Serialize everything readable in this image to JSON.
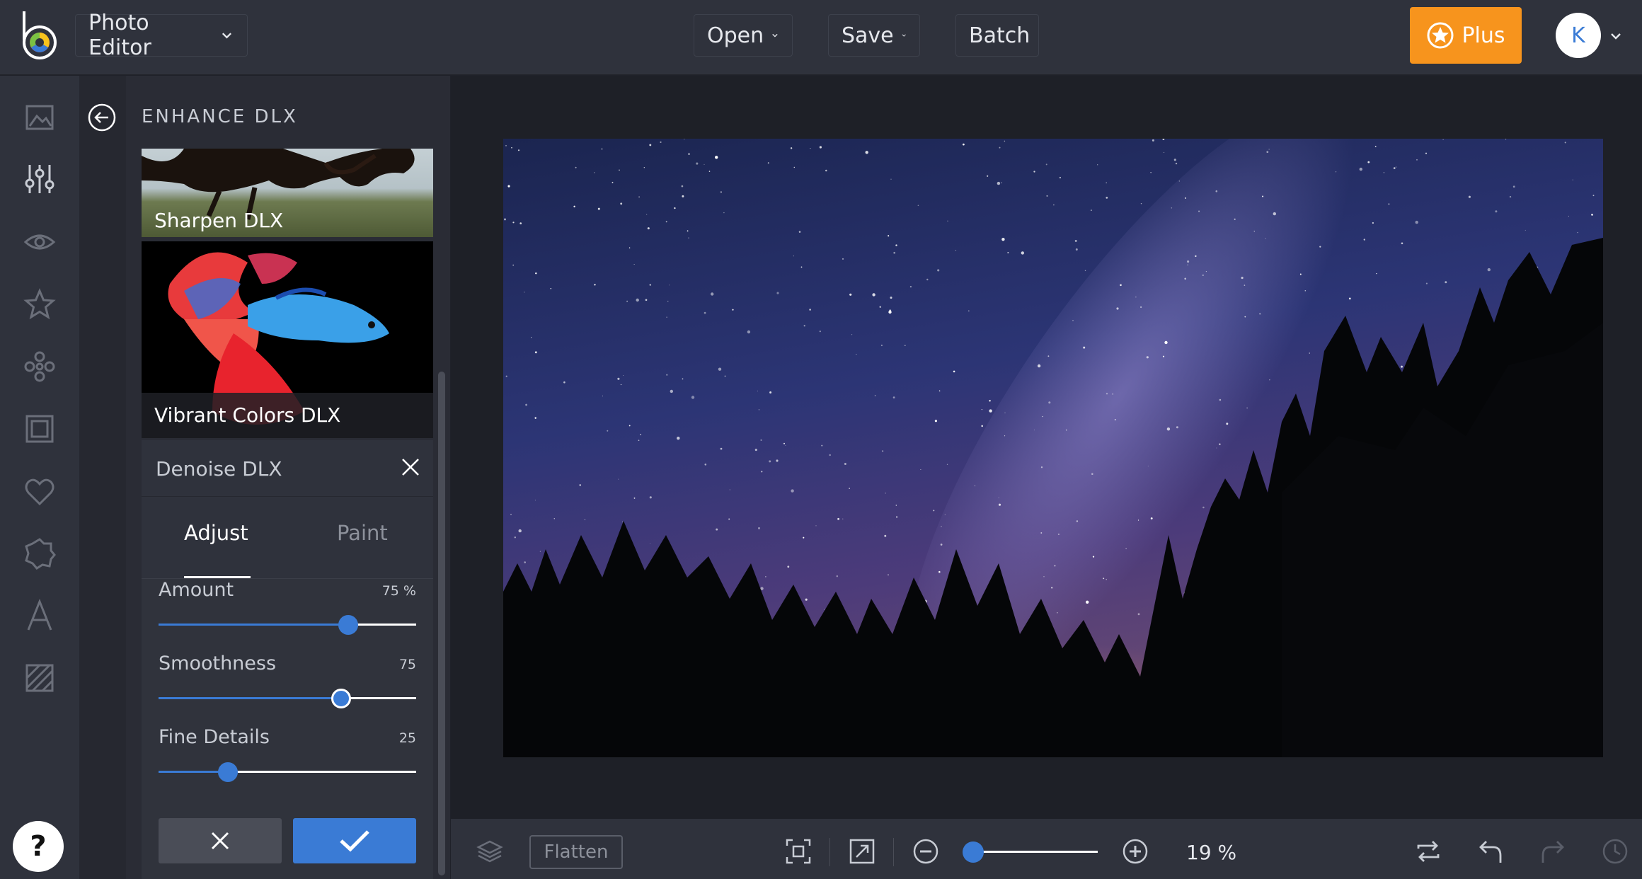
{
  "header": {
    "app_menu_label": "Photo Editor",
    "open_label": "Open",
    "save_label": "Save",
    "batch_label": "Batch",
    "plus_label": "Plus",
    "avatar_initial": "K"
  },
  "rail": {
    "icons": [
      "image-icon",
      "sliders-icon",
      "eye-icon",
      "star-icon",
      "flower-icon",
      "frame-icon",
      "heart-icon",
      "badge-icon",
      "text-icon",
      "texture-icon"
    ],
    "help_label": "?"
  },
  "panel": {
    "title": "ENHANCE DLX",
    "thumbnails": [
      {
        "label": "Sharpen DLX"
      },
      {
        "label": "Vibrant Colors DLX"
      }
    ],
    "tool": {
      "title": "Denoise DLX",
      "tabs": [
        {
          "label": "Adjust",
          "active": true
        },
        {
          "label": "Paint",
          "active": false
        }
      ],
      "sliders": [
        {
          "label": "Amount",
          "value_text": "75 %",
          "value": 0.735
        },
        {
          "label": "Smoothness",
          "value_text": "75",
          "value": 0.71
        },
        {
          "label": "Fine Details",
          "value_text": "25",
          "value": 0.27
        }
      ]
    }
  },
  "bottombar": {
    "flatten_label": "Flatten",
    "zoom_text": "19 %",
    "zoom_level": 0.19
  },
  "colors": {
    "accent": "#3a7bd5",
    "plus": "#f7941d",
    "topbar": "#2f323c"
  }
}
